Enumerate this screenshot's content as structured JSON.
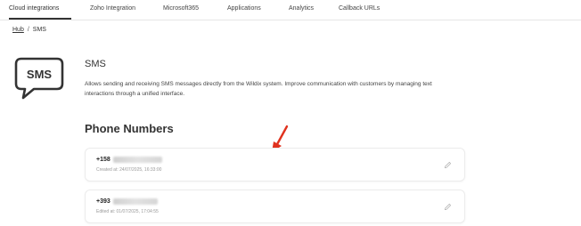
{
  "tabs": [
    {
      "label": "Cloud integrations"
    },
    {
      "label": "Zoho Integration"
    },
    {
      "label": "Microsoft365"
    },
    {
      "label": "Applications"
    },
    {
      "label": "Analytics"
    },
    {
      "label": "Callback URLs"
    }
  ],
  "breadcrumb": {
    "hub": "Hub",
    "separator": "/",
    "current": "SMS"
  },
  "icon": {
    "text": "SMS",
    "name": "sms-chat-bubble-icon"
  },
  "page": {
    "title": "SMS",
    "description": "Allows sending and receiving SMS messages directly from the Wildix system. Improve communication with customers by managing text interactions through a unified interface."
  },
  "phone_numbers": {
    "section_title": "Phone Numbers",
    "items": [
      {
        "prefix": "+158",
        "meta": "Created at: 24/07/2025, 16:33:00"
      },
      {
        "prefix": "+393",
        "meta": "Edited at: 01/07/2025, 17:04:55"
      }
    ]
  },
  "colors": {
    "annotation_arrow": "#e0321e",
    "accent_text": "#333333"
  }
}
